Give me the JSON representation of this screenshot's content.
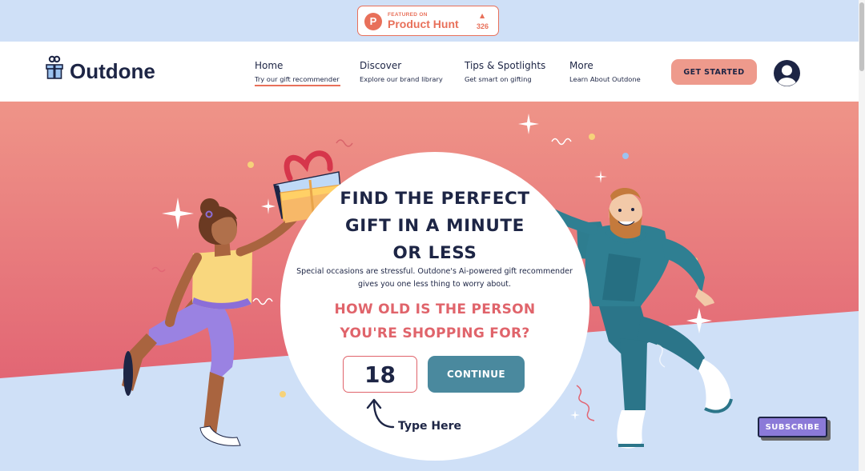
{
  "product_hunt": {
    "featured_label": "FEATURED ON",
    "name": "Product Hunt",
    "upvote_count": "326",
    "logo_letter": "P"
  },
  "brand": {
    "name": "Outdone"
  },
  "nav": {
    "items": [
      {
        "title": "Home",
        "subtitle": "Try our gift recommender",
        "active": true
      },
      {
        "title": "Discover",
        "subtitle": "Explore our brand library",
        "active": false
      },
      {
        "title": "Tips & Spotlights",
        "subtitle": "Get smart on gifting",
        "active": false
      },
      {
        "title": "More",
        "subtitle": "Learn About Outdone",
        "active": false
      }
    ],
    "cta_label": "GET STARTED"
  },
  "hero": {
    "headline_lines": [
      "FIND THE PERFECT",
      "GIFT IN A MINUTE",
      "OR LESS"
    ],
    "subtext_lines": [
      "Special occasions are stressful. Outdone's Ai-powered gift recommender",
      "gives you one less thing to worry about."
    ],
    "question_lines": [
      "HOW OLD IS THE PERSON",
      "YOU'RE SHOPPING FOR?"
    ],
    "age_value": "18",
    "continue_label": "CONTINUE",
    "hint": "Type Here"
  },
  "subscribe_label": "SUBSCRIBE",
  "colors": {
    "navy": "#1d2545",
    "coral": "#e8705a",
    "salmon": "#ee9a8c",
    "pink_red": "#e0646b",
    "teal": "#4a899e",
    "light_blue": "#cfe0f7",
    "purple": "#8b7ad8"
  },
  "icons": [
    "product-hunt-logo-icon",
    "upvote-arrow-icon",
    "gift-logo-icon",
    "user-avatar-icon",
    "curved-arrow-icon",
    "sparkle-icon",
    "gift-box-icon"
  ]
}
